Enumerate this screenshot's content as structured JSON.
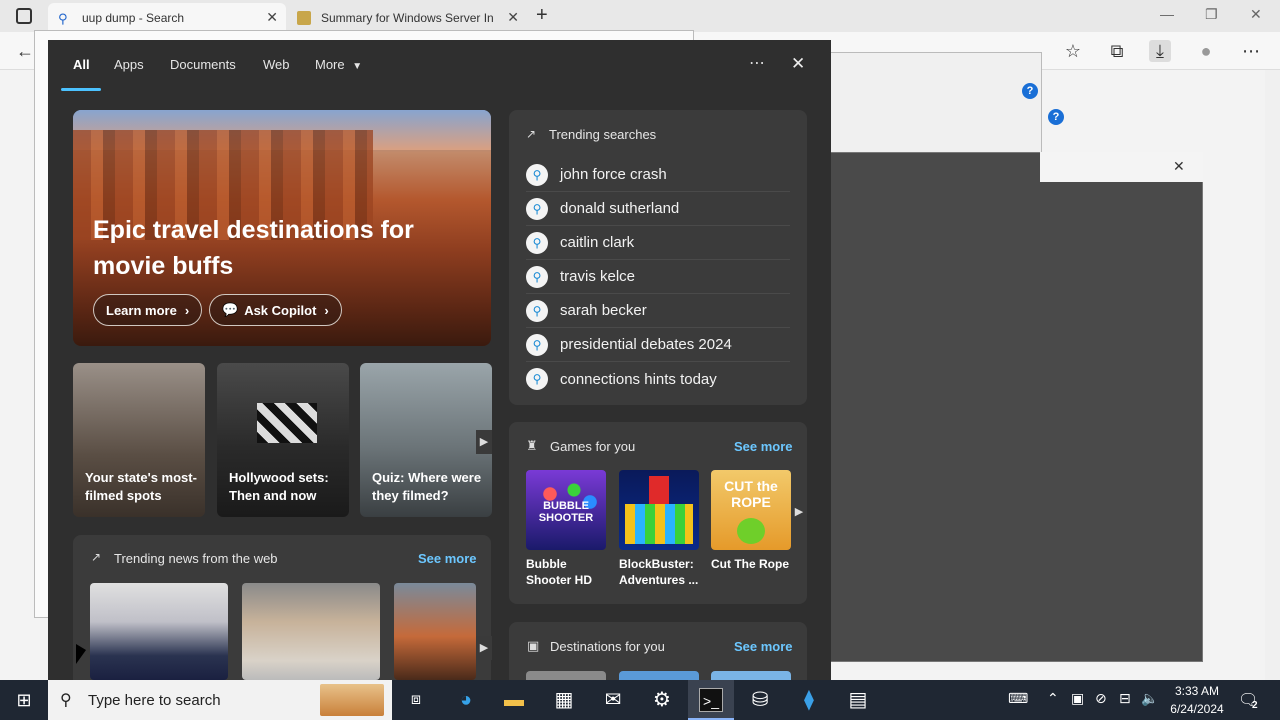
{
  "browser": {
    "tabs": [
      {
        "title": "uup dump - Search"
      },
      {
        "title": "Summary for Windows Server In"
      }
    ],
    "new_tab": "+"
  },
  "panel": {
    "nav": {
      "all": "All",
      "apps": "Apps",
      "documents": "Documents",
      "web": "Web",
      "more": "More"
    },
    "hero": {
      "title": "Epic travel destinations for movie buffs",
      "learn_more": "Learn more",
      "ask_copilot": "Ask Copilot"
    },
    "cards": [
      {
        "caption": "Your state's most-filmed spots"
      },
      {
        "caption": "Hollywood sets: Then and now"
      },
      {
        "caption": "Quiz: Where were they filmed?"
      }
    ],
    "trending_searches": {
      "title": "Trending searches",
      "items": [
        "john force crash",
        "donald sutherland",
        "caitlin clark",
        "travis kelce",
        "sarah becker",
        "presidential debates 2024",
        "connections hints today"
      ]
    },
    "games": {
      "title": "Games for you",
      "see_more": "See more",
      "items": [
        {
          "name": "Bubble Shooter HD",
          "art": "BUBBLE SHOOTER"
        },
        {
          "name": "BlockBuster: Adventures ..."
        },
        {
          "name": "Cut The Rope",
          "art": "CUT the ROPE"
        }
      ]
    },
    "news": {
      "title": "Trending news from the web",
      "see_more": "See more"
    },
    "destinations": {
      "title": "Destinations for you",
      "see_more": "See more"
    }
  },
  "taskbar": {
    "search_placeholder": "Type here to search",
    "time": "3:33 AM",
    "date": "6/24/2024",
    "notifications": "2"
  }
}
